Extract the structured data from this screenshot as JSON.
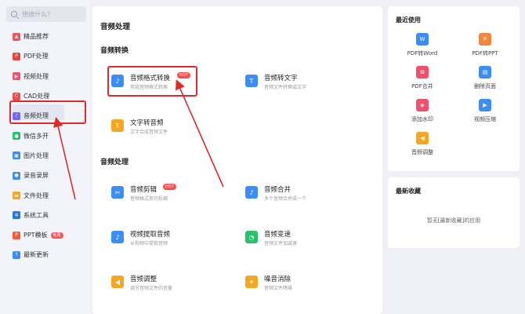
{
  "search": {
    "placeholder": "想搜什么？"
  },
  "sidebar": {
    "items": [
      {
        "label": "精品推荐",
        "icon": "thumbs-up-icon",
        "color": "#f0505a"
      },
      {
        "label": "PDF处理",
        "icon": "pdf-icon",
        "color": "#e8453c"
      },
      {
        "label": "视频处理",
        "icon": "video-icon",
        "color": "#f0506e"
      },
      {
        "label": "CAD处理",
        "icon": "cad-icon",
        "color": "#e94f4f"
      },
      {
        "label": "音频处理",
        "icon": "audio-icon",
        "color": "#7b61ff"
      },
      {
        "label": "微信多开",
        "icon": "wechat-icon",
        "color": "#27c36b"
      },
      {
        "label": "图片处理",
        "icon": "image-icon",
        "color": "#3a8ef6"
      },
      {
        "label": "录音录屏",
        "icon": "mic-icon",
        "color": "#3a8ef6"
      },
      {
        "label": "文件处理",
        "icon": "folder-icon",
        "color": "#f5a623"
      },
      {
        "label": "系统工具",
        "icon": "gear-icon",
        "color": "#1f7ae0"
      },
      {
        "label": "PPT模板",
        "icon": "ppt-icon",
        "color": "#f05a3a",
        "badge": "免费"
      },
      {
        "label": "最新更新",
        "icon": "update-icon",
        "color": "#3a8ef6"
      }
    ]
  },
  "main": {
    "page_title": "音频处理",
    "section1_title": "音频转换",
    "section2_title": "音频处理",
    "hot": "HOT",
    "tools": [
      {
        "name": "音频格式转换",
        "desc": "常规音频格式转换",
        "icon": "audio-convert-icon",
        "color": "#3a8ef6"
      },
      {
        "name": "音频转文字",
        "desc": "音频文件转换成文字",
        "icon": "audio-to-text-icon",
        "color": "#3a8ef6"
      },
      {
        "name": "文字转音频",
        "desc": "文字合成音频文件",
        "icon": "text-to-audio-icon",
        "color": "#f5a623"
      },
      {
        "name": "音频剪辑",
        "desc": "音频格式剪切拆细",
        "icon": "audio-cut-icon",
        "color": "#3a8ef6"
      },
      {
        "name": "音频合并",
        "desc": "多个音频合并成一个",
        "icon": "audio-merge-icon",
        "color": "#3a8ef6"
      },
      {
        "name": "视频提取音频",
        "desc": "从视频中提取音频",
        "icon": "video-extract-audio-icon",
        "color": "#3a8ef6"
      },
      {
        "name": "音频变速",
        "desc": "音频文件加减速",
        "icon": "audio-speed-icon",
        "color": "#27c36b"
      },
      {
        "name": "音频调整",
        "desc": "调节音频文件的音量",
        "icon": "audio-volume-icon",
        "color": "#f5a623"
      },
      {
        "name": "噪音消除",
        "desc": "音频文件降噪",
        "icon": "noise-remove-icon",
        "color": "#f5a623"
      }
    ]
  },
  "recent": {
    "title": "最近使用",
    "items": [
      {
        "label": "PDF转Word",
        "icon": "pdf-to-word-icon",
        "color": "#3a8ef6"
      },
      {
        "label": "PDF转PPT",
        "icon": "pdf-to-ppt-icon",
        "color": "#f5853a"
      },
      {
        "label": "PDF合并",
        "icon": "pdf-merge-icon",
        "color": "#f0506e"
      },
      {
        "label": "删除页面",
        "icon": "delete-page-icon",
        "color": "#3a8ef6"
      },
      {
        "label": "添加水印",
        "icon": "watermark-icon",
        "color": "#f0506e"
      },
      {
        "label": "视频压缩",
        "icon": "video-compress-icon",
        "color": "#3a8ef6"
      },
      {
        "label": "音频调整",
        "icon": "audio-volume-icon",
        "color": "#f5a623"
      }
    ]
  },
  "favorites": {
    "title": "最新收藏",
    "empty": "暂无[最新收藏]的应用"
  }
}
